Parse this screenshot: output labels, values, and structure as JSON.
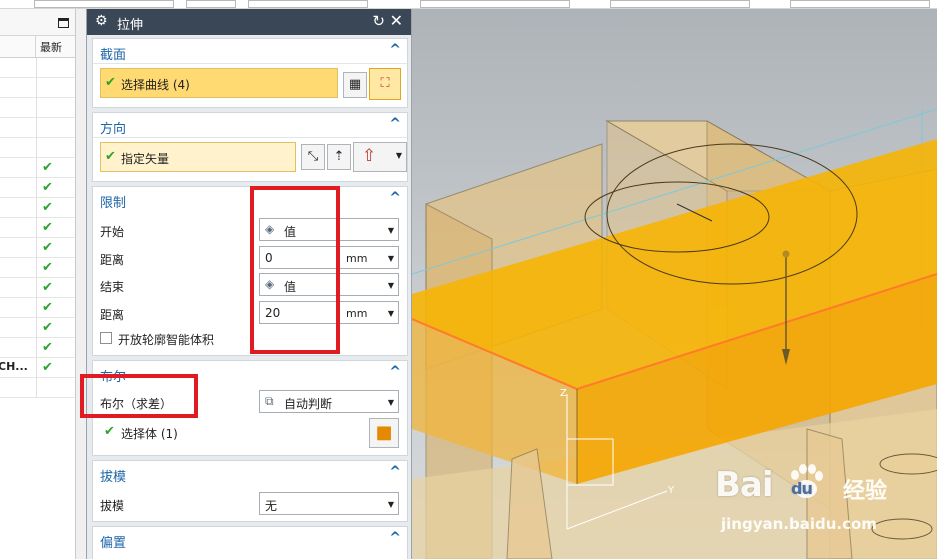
{
  "navigator": {
    "column_latest": "最新",
    "truncated_item": "CH...",
    "rows": 17,
    "checked_rows": [
      5,
      6,
      7,
      8,
      9,
      10,
      11,
      12,
      13,
      14,
      15
    ]
  },
  "dialog": {
    "title": "拉伸",
    "section": {
      "label": "截面",
      "select": "选择曲线 (4)"
    },
    "direction": {
      "label": "方向",
      "select": "指定矢量"
    },
    "limits": {
      "label": "限制",
      "start_label": "开始",
      "start_value": "值",
      "start_dist_label": "距离",
      "start_dist": "0",
      "end_label": "结束",
      "end_value": "值",
      "end_dist_label": "距离",
      "end_dist": "20",
      "unit": "mm",
      "open_profile": "开放轮廓智能体积"
    },
    "boolean": {
      "label": "布尔",
      "op_label": "布尔（求差）",
      "op_value": "自动判断",
      "select_body": "选择体 (1)"
    },
    "draft": {
      "label": "拔模",
      "field_label": "拔模",
      "field_value": "无"
    },
    "offset": {
      "label": "偏置"
    }
  },
  "viewport": {
    "axis_z": "Z",
    "axis_y": "Y",
    "watermark_logo": "Bai",
    "watermark_logo2": "du",
    "watermark_cn": "经验",
    "watermark_url": "jingyan.baidu.com"
  },
  "colors": {
    "title_bar": "#3a4756",
    "section_title": "#1f66a8",
    "selection_fill": "#ffd971",
    "check": "#2aa52a",
    "highlight_box": "#e11b22",
    "extrude_orange": "#f5a600",
    "body_tan": "#e6c487"
  }
}
